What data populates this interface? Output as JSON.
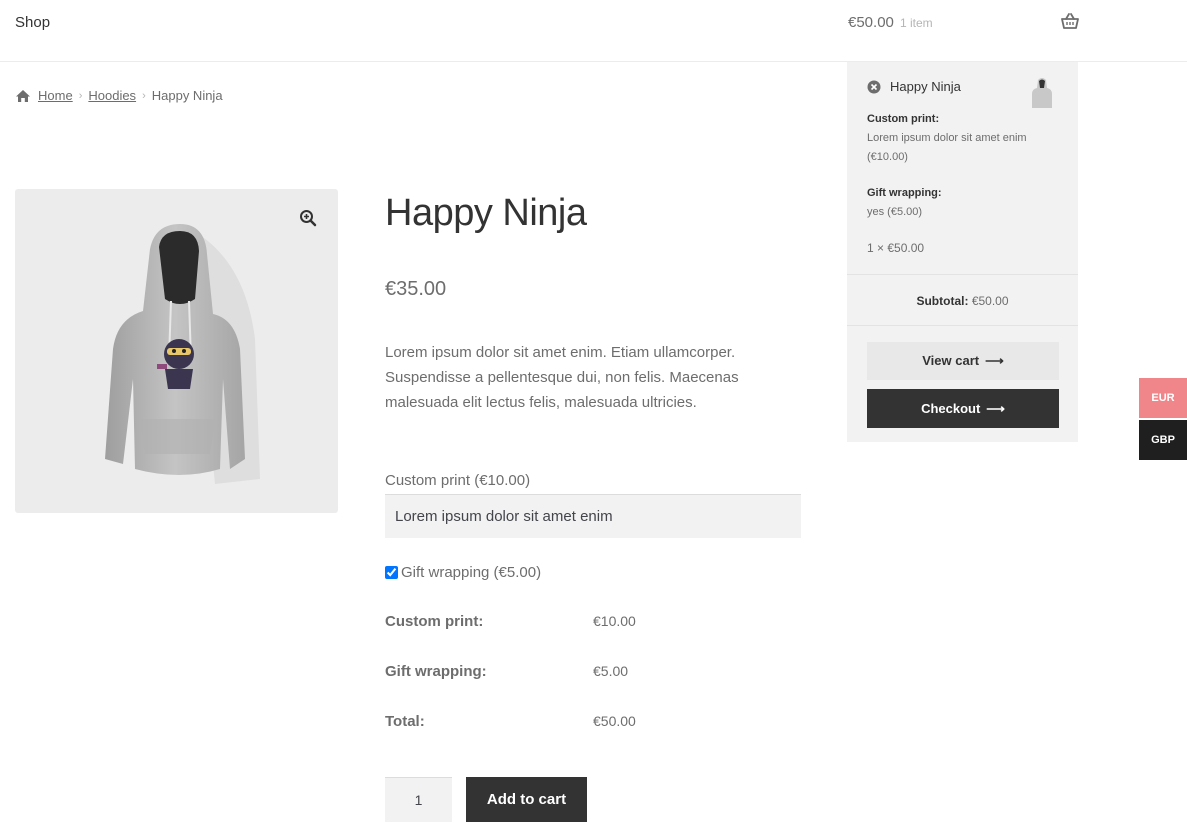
{
  "header": {
    "nav_shop": "Shop",
    "cart_total": "€50.00",
    "cart_count": "1 item",
    "basket_icon": "basket-icon"
  },
  "breadcrumb": {
    "home_icon": "home-icon",
    "items": [
      "Home",
      "Hoodies",
      "Happy Ninja"
    ]
  },
  "product": {
    "title": "Happy Ninja",
    "price": "€35.00",
    "description": "Lorem ipsum dolor sit amet enim. Etiam ullamcorper. Suspendisse a pellentesque dui, non felis. Maecenas malesuada elit lectus felis, malesuada ultricies.",
    "zoom_icon": "magnifier-plus-icon",
    "custom_print_label": "Custom print (€10.00)",
    "custom_print_value": "Lorem ipsum dolor sit amet enim",
    "gift_wrapping_label": "Gift wrapping (€5.00)",
    "gift_wrapping_checked": true,
    "totals": [
      {
        "label": "Custom print:",
        "value": "€10.00"
      },
      {
        "label": "Gift wrapping:",
        "value": "€5.00"
      },
      {
        "label": "Total:",
        "value": "€50.00"
      }
    ],
    "quantity": "1",
    "add_to_cart_label": "Add to cart"
  },
  "mini_cart": {
    "item_name": "Happy Ninja",
    "custom_print_label": "Custom print:",
    "custom_print_value": "Lorem ipsum dolor sit amet enim (€10.00)",
    "gift_wrapping_label": "Gift wrapping:",
    "gift_wrapping_value": "yes (€5.00)",
    "qty_line": "1 × €50.00",
    "subtotal_label": "Subtotal:",
    "subtotal_value": "€50.00",
    "view_cart_label": "View cart",
    "checkout_label": "Checkout"
  },
  "currency_switcher": {
    "eur": "EUR",
    "gbp": "GBP",
    "active_color": "#f0858a"
  }
}
